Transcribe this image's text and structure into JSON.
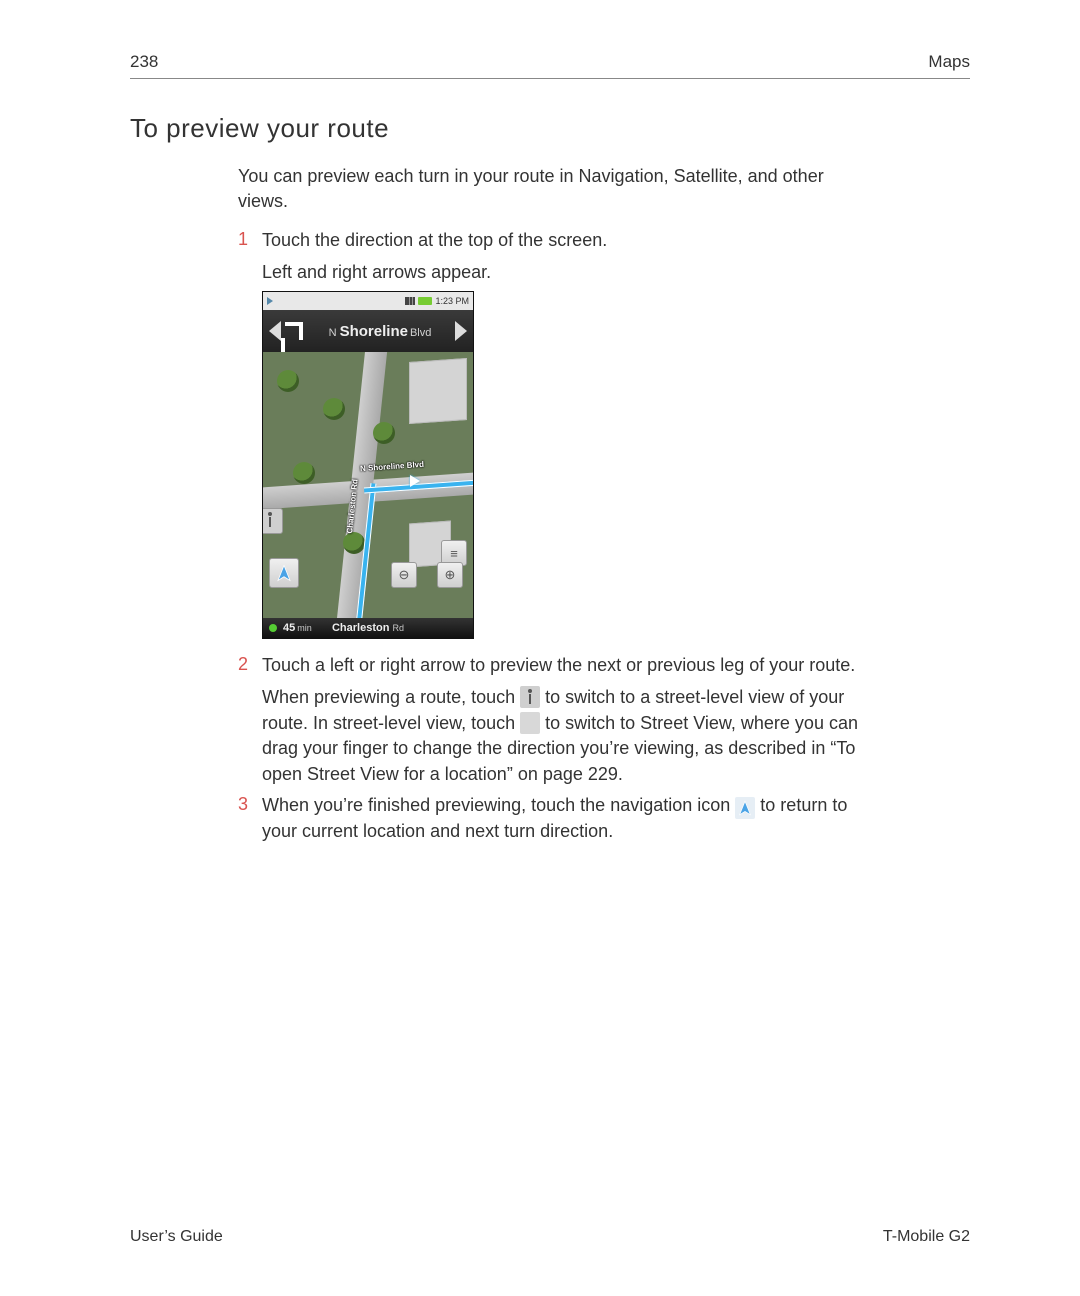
{
  "header": {
    "page_number": "238",
    "section": "Maps"
  },
  "section_title": "To preview your route",
  "intro": "You can preview each turn in your route in Navigation, Satellite, and other views.",
  "steps": {
    "s1": {
      "num": "1",
      "line1": "Touch the direction at the top of the screen.",
      "line2": "Left and right arrows appear."
    },
    "s2": {
      "num": "2",
      "line1": "Touch a left or right arrow to preview the next or previous leg of your route.",
      "p2_a": "When previewing a route, touch ",
      "p2_b": " to switch to a street-level view of your route. In street-level view, touch ",
      "p2_c": " to switch to Street View, where you can drag your finger to change the direction you’re viewing, as described in “To open Street View for a location” on page 229."
    },
    "s3": {
      "num": "3",
      "p_a": "When you’re finished previewing, touch the navigation icon ",
      "p_b": " to return to your current location and next turn direction."
    }
  },
  "screenshot": {
    "status_time": "1:23 PM",
    "direction": {
      "prefix": "N",
      "street": "Shoreline",
      "suffix": "Blvd"
    },
    "sign_h": "N Shoreline Blvd",
    "sign_v": "Charleston Rd",
    "eta_value": "45",
    "eta_unit": "min",
    "bottom_street": "Charleston",
    "bottom_suffix": "Rd",
    "zoom_out": "⊖",
    "zoom_in": "⊕",
    "list_glyph": "≡"
  },
  "footer": {
    "left": "User’s Guide",
    "right": "T-Mobile G2"
  }
}
